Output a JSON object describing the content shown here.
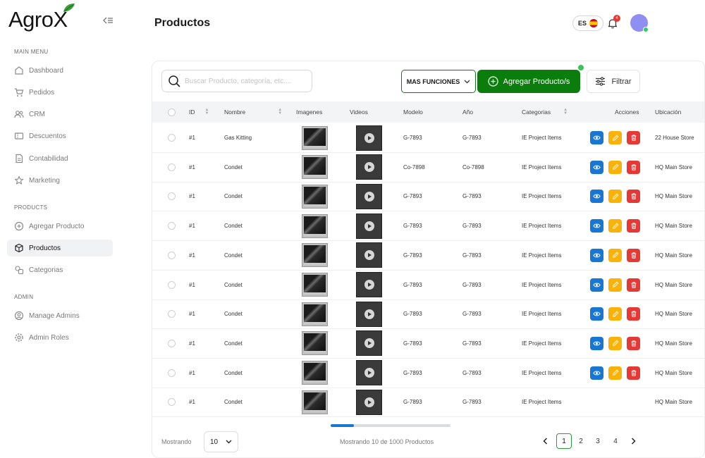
{
  "brand": {
    "name": "Agro",
    "mark": "X"
  },
  "sidebar": {
    "sections": [
      {
        "label": "MAIN MENU"
      },
      {
        "label": "PRODUCTS"
      },
      {
        "label": "ADMIN"
      }
    ],
    "items": [
      {
        "label": "Dashboard",
        "icon": "home-icon"
      },
      {
        "label": "Pedidos",
        "icon": "cart-icon"
      },
      {
        "label": "CRM",
        "icon": "users-icon"
      },
      {
        "label": "Descuentos",
        "icon": "ticket-icon"
      },
      {
        "label": "Contabilidad",
        "icon": "document-icon"
      },
      {
        "label": "Marketing",
        "icon": "star-icon"
      },
      {
        "label": "Agregar Producto",
        "icon": "plus-circle-icon"
      },
      {
        "label": "Productos",
        "icon": "box-icon",
        "active": true
      },
      {
        "label": "Categorias",
        "icon": "categories-icon"
      },
      {
        "label": "Manage Admins",
        "icon": "user-circle-icon"
      },
      {
        "label": "Admin Roles",
        "icon": "gear-icon"
      }
    ]
  },
  "header": {
    "title": "Productos",
    "language": "ES",
    "notifications": "4"
  },
  "toolbar": {
    "search_placeholder": "Buscar Producto, categoría, etc....",
    "more_label": "MAS FUNCIONES",
    "add_label": "Agregar Producto/s",
    "filter_label": "Filtrar"
  },
  "table": {
    "columns": {
      "id": "ID",
      "name": "Nombre",
      "images": "Imagenes",
      "videos": "Videos",
      "model": "Modelo",
      "year": "Año",
      "category": "Categorias",
      "actions": "Acciones",
      "location": "Ubicación"
    },
    "rows": [
      {
        "id": "#1",
        "name": "Gas Kitting",
        "model": "G-7893",
        "year": "G-7893",
        "category": "IE Project Items",
        "location": "22 House Store",
        "actions": true
      },
      {
        "id": "#1",
        "name": "Condet",
        "model": "Co-7898",
        "year": "Co-7898",
        "category": "IE Project Items",
        "location": "HQ Main Store",
        "actions": true
      },
      {
        "id": "#1",
        "name": "Condet",
        "model": "G-7893",
        "year": "G-7893",
        "category": "IE Project Items",
        "location": "HQ Main Store",
        "actions": true
      },
      {
        "id": "#1",
        "name": "Condet",
        "model": "G-7893",
        "year": "G-7893",
        "category": "IE Project Items",
        "location": "HQ Main Store",
        "actions": true
      },
      {
        "id": "#1",
        "name": "Condet",
        "model": "G-7893",
        "year": "G-7893",
        "category": "IE Project Items",
        "location": "HQ Main Store",
        "actions": true
      },
      {
        "id": "#1",
        "name": "Condet",
        "model": "G-7893",
        "year": "G-7893",
        "category": "IE Project Items",
        "location": "HQ Main Store",
        "actions": true
      },
      {
        "id": "#1",
        "name": "Condet",
        "model": "G-7893",
        "year": "G-7893",
        "category": "IE Project Items",
        "location": "HQ Main Store",
        "actions": true
      },
      {
        "id": "#1",
        "name": "Condet",
        "model": "G-7893",
        "year": "G-7893",
        "category": "IE Project Items",
        "location": "HQ Main Store",
        "actions": true
      },
      {
        "id": "#1",
        "name": "Condet",
        "model": "G-7893",
        "year": "G-7893",
        "category": "IE Project Items",
        "location": "HQ Main Store",
        "actions": true
      },
      {
        "id": "#1",
        "name": "Condet",
        "model": "G-7893",
        "year": "G-7893",
        "category": "IE Project Items",
        "location": "HQ Main Store",
        "actions": false
      }
    ]
  },
  "footer": {
    "showing_label": "Mostrando",
    "page_size": "10",
    "summary": "Mostrando 10 de 1000 Productos",
    "pages": [
      "1",
      "2",
      "3",
      "4"
    ],
    "current_page": "1"
  },
  "colors": {
    "primary_green": "#0b7d0d",
    "view_blue": "#1976d2",
    "edit_yellow": "#f9b208",
    "delete_red": "#e53935",
    "avatar": "#8e8ff0"
  }
}
